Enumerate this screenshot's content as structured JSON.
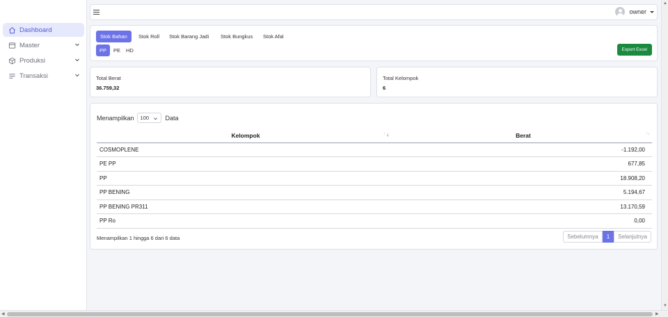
{
  "sidebar": {
    "items": [
      {
        "label": "Dashboard",
        "icon": "home-icon",
        "active": true
      },
      {
        "label": "Master",
        "icon": "window-icon",
        "has_children": true
      },
      {
        "label": "Produksi",
        "icon": "box-icon",
        "has_children": true
      },
      {
        "label": "Transaksi",
        "icon": "list-icon",
        "has_children": true
      }
    ]
  },
  "topbar": {
    "user_name": "owner"
  },
  "tabs": [
    "Stok Bahan",
    "Stok Roll",
    "Stok Barang Jadi",
    "Stok Bungkus",
    "Stok Afal"
  ],
  "active_tab": "Stok Bahan",
  "subtabs": [
    "PP",
    "PE",
    "HD"
  ],
  "active_subtab": "PP",
  "export_label": "Export Excel",
  "stats": {
    "total_berat_label": "Total Berat",
    "total_berat_value": "36.759,32",
    "total_kelompok_label": "Total Kelompok",
    "total_kelompok_value": "6"
  },
  "table": {
    "length_prefix": "Menampilkan",
    "length_value": "100",
    "length_suffix": "Data",
    "columns": [
      "Kelompok",
      "Berat"
    ],
    "rows": [
      {
        "kelompok": "COSMOPLENE",
        "berat": "-1.192,00"
      },
      {
        "kelompok": "PE PP",
        "berat": "677,85"
      },
      {
        "kelompok": "PP",
        "berat": "18.908,20"
      },
      {
        "kelompok": "PP BENING",
        "berat": "5.194,67"
      },
      {
        "kelompok": "PP BENING PR311",
        "berat": "13.170,59"
      },
      {
        "kelompok": "PP Ro",
        "berat": "0,00"
      }
    ],
    "info": "Menampilkan 1 hingga 6 dari 6 data",
    "pagination": {
      "prev": "Sebelumnya",
      "page": "1",
      "next": "Selanjutnya"
    }
  },
  "colors": {
    "accent": "#6c72e8",
    "export_button": "#1a8a3e",
    "sidebar_active_bg": "#e6e8fc"
  }
}
